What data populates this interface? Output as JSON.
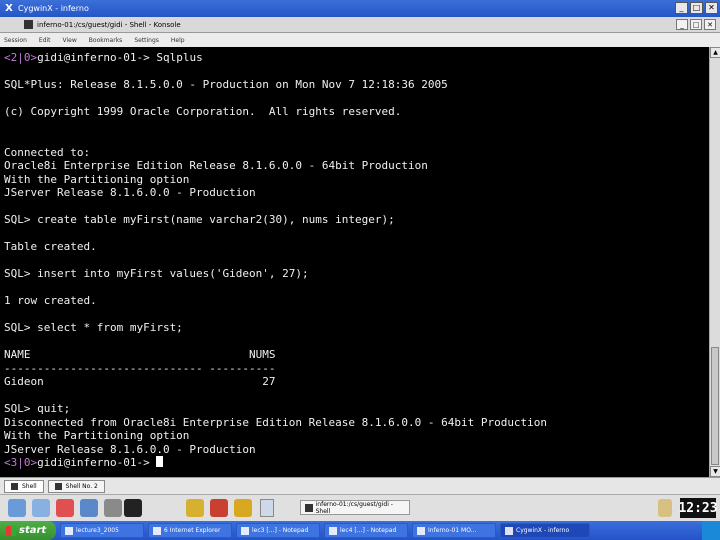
{
  "window": {
    "outer_title": "CygwinX - inferno",
    "inner_title": "inferno-01:/cs/guest/gidi - Shell - Konsole"
  },
  "menu": [
    "Session",
    "Edit",
    "View",
    "Bookmarks",
    "Settings",
    "Help"
  ],
  "terminal": {
    "lines": [
      {
        "prompt": "<2|0>",
        "text": "gidi@inferno-01-> Sqlplus"
      },
      {
        "text": ""
      },
      {
        "text": "SQL*Plus: Release 8.1.5.0.0 - Production on Mon Nov 7 12:18:36 2005"
      },
      {
        "text": ""
      },
      {
        "text": "(c) Copyright 1999 Oracle Corporation.  All rights reserved."
      },
      {
        "text": ""
      },
      {
        "text": ""
      },
      {
        "text": "Connected to:"
      },
      {
        "text": "Oracle8i Enterprise Edition Release 8.1.6.0.0 - 64bit Production"
      },
      {
        "text": "With the Partitioning option"
      },
      {
        "text": "JServer Release 8.1.6.0.0 - Production"
      },
      {
        "text": ""
      },
      {
        "text": "SQL> create table myFirst(name varchar2(30), nums integer);"
      },
      {
        "text": ""
      },
      {
        "text": "Table created."
      },
      {
        "text": ""
      },
      {
        "text": "SQL> insert into myFirst values('Gideon', 27);"
      },
      {
        "text": ""
      },
      {
        "text": "1 row created."
      },
      {
        "text": ""
      },
      {
        "text": "SQL> select * from myFirst;"
      },
      {
        "text": ""
      },
      {
        "text": "NAME                                 NUMS"
      },
      {
        "text": "------------------------------ ----------"
      },
      {
        "text": "Gideon                                 27"
      },
      {
        "text": ""
      },
      {
        "text": "SQL> quit;"
      },
      {
        "text": "Disconnected from Oracle8i Enterprise Edition Release 8.1.6.0.0 - 64bit Production"
      },
      {
        "text": "With the Partitioning option"
      },
      {
        "text": "JServer Release 8.1.6.0.0 - Production"
      },
      {
        "prompt": "<3|0>",
        "text": "gidi@inferno-01-> ",
        "cursor": true
      }
    ]
  },
  "session_tabs": [
    {
      "label": "Shell",
      "active": true
    },
    {
      "label": "Shell No. 2",
      "active": false
    }
  ],
  "kde_panel": {
    "task_label": "inferno-01:/cs/guest/gidi - Shell",
    "clock": "12:23"
  },
  "win_taskbar": {
    "start_label": "start",
    "tasks": [
      "lecture3_2005",
      "6 Internet Explorer",
      "lec3 [...] - Notepad",
      "lec4 [...] - Notepad",
      "Inferno-01 MO...",
      "CygwinX - inferno"
    ]
  }
}
